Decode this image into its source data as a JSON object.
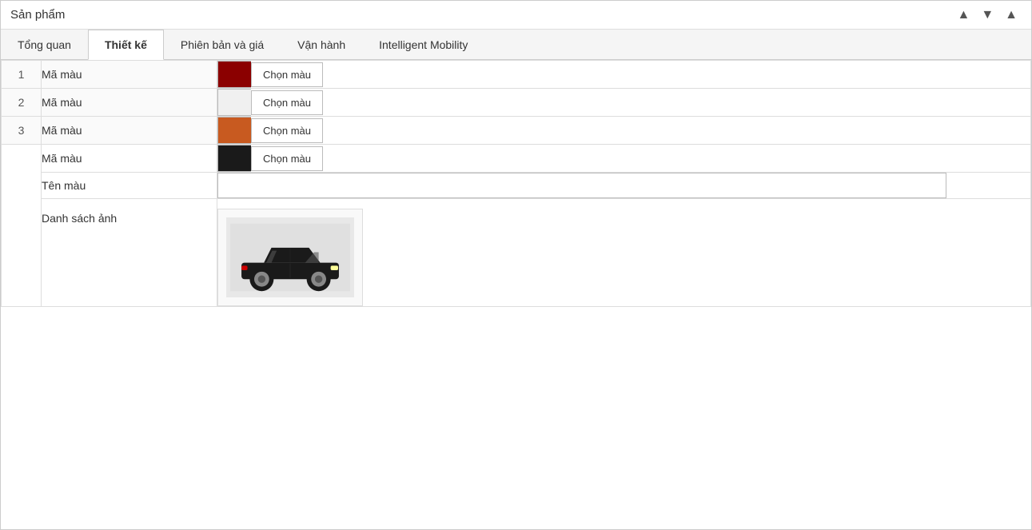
{
  "window": {
    "title": "Sản phẩm",
    "btn_up": "▲",
    "btn_down": "▼",
    "btn_close": "▲"
  },
  "tabs": [
    {
      "id": "tong-quan",
      "label": "Tổng quan",
      "active": false
    },
    {
      "id": "thiet-ke",
      "label": "Thiết kế",
      "active": true
    },
    {
      "id": "phien-ban",
      "label": "Phiên bản và giá",
      "active": false
    },
    {
      "id": "van-hanh",
      "label": "Vận hành",
      "active": false
    },
    {
      "id": "intelligent",
      "label": "Intelligent Mobility",
      "active": false
    }
  ],
  "rows": [
    {
      "num": "1",
      "label": "Mã màu",
      "swatch": "#8B0000",
      "btn": "Chọn màu"
    },
    {
      "num": "2",
      "label": "Mã màu",
      "swatch": "#f0f0f0",
      "btn": "Chọn màu"
    },
    {
      "num": "3",
      "label": "Mã màu",
      "swatch": "#C85A20",
      "btn": "Chọn màu"
    }
  ],
  "expanded": {
    "color_label": "Mã màu",
    "color_swatch": "#1a1a1a",
    "color_btn": "Chọn màu",
    "name_label": "Tên màu",
    "name_placeholder": "",
    "image_label": "Danh sách ảnh"
  }
}
